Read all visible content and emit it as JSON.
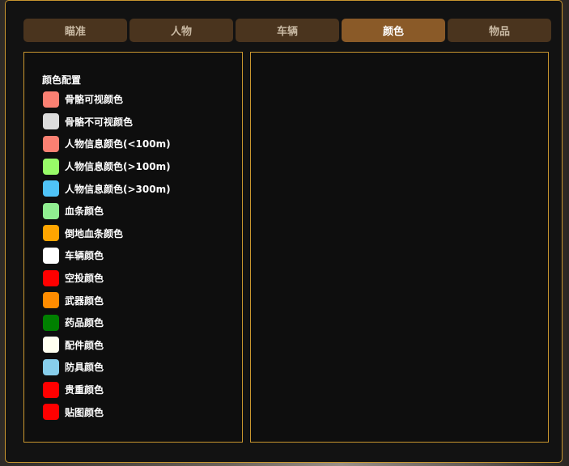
{
  "tabs": [
    {
      "label": "瞄准",
      "active": false
    },
    {
      "label": "人物",
      "active": false
    },
    {
      "label": "车辆",
      "active": false
    },
    {
      "label": "颜色",
      "active": true
    },
    {
      "label": "物品",
      "active": false
    }
  ],
  "color_config": {
    "title": "颜色配置",
    "items": [
      {
        "label": "骨骼可视颜色",
        "color": "#fa8072"
      },
      {
        "label": "骨骼不可视颜色",
        "color": "#dcdcdc"
      },
      {
        "label": "人物信息颜色(<100m)",
        "color": "#fa8072"
      },
      {
        "label": "人物信息颜色(>100m)",
        "color": "#98fb68"
      },
      {
        "label": "人物信息颜色(>300m)",
        "color": "#4fc3f7"
      },
      {
        "label": "血条颜色",
        "color": "#90ee90"
      },
      {
        "label": "倒地血条颜色",
        "color": "#ffa500"
      },
      {
        "label": "车辆颜色",
        "color": "#ffffff"
      },
      {
        "label": "空投颜色",
        "color": "#ff0000"
      },
      {
        "label": "武器颜色",
        "color": "#ff8c00"
      },
      {
        "label": "药品颜色",
        "color": "#008000"
      },
      {
        "label": "配件颜色",
        "color": "#fffff0"
      },
      {
        "label": "防具颜色",
        "color": "#87ceeb"
      },
      {
        "label": "贵重颜色",
        "color": "#ff0000"
      },
      {
        "label": "贴图颜色",
        "color": "#ff0000"
      }
    ]
  }
}
